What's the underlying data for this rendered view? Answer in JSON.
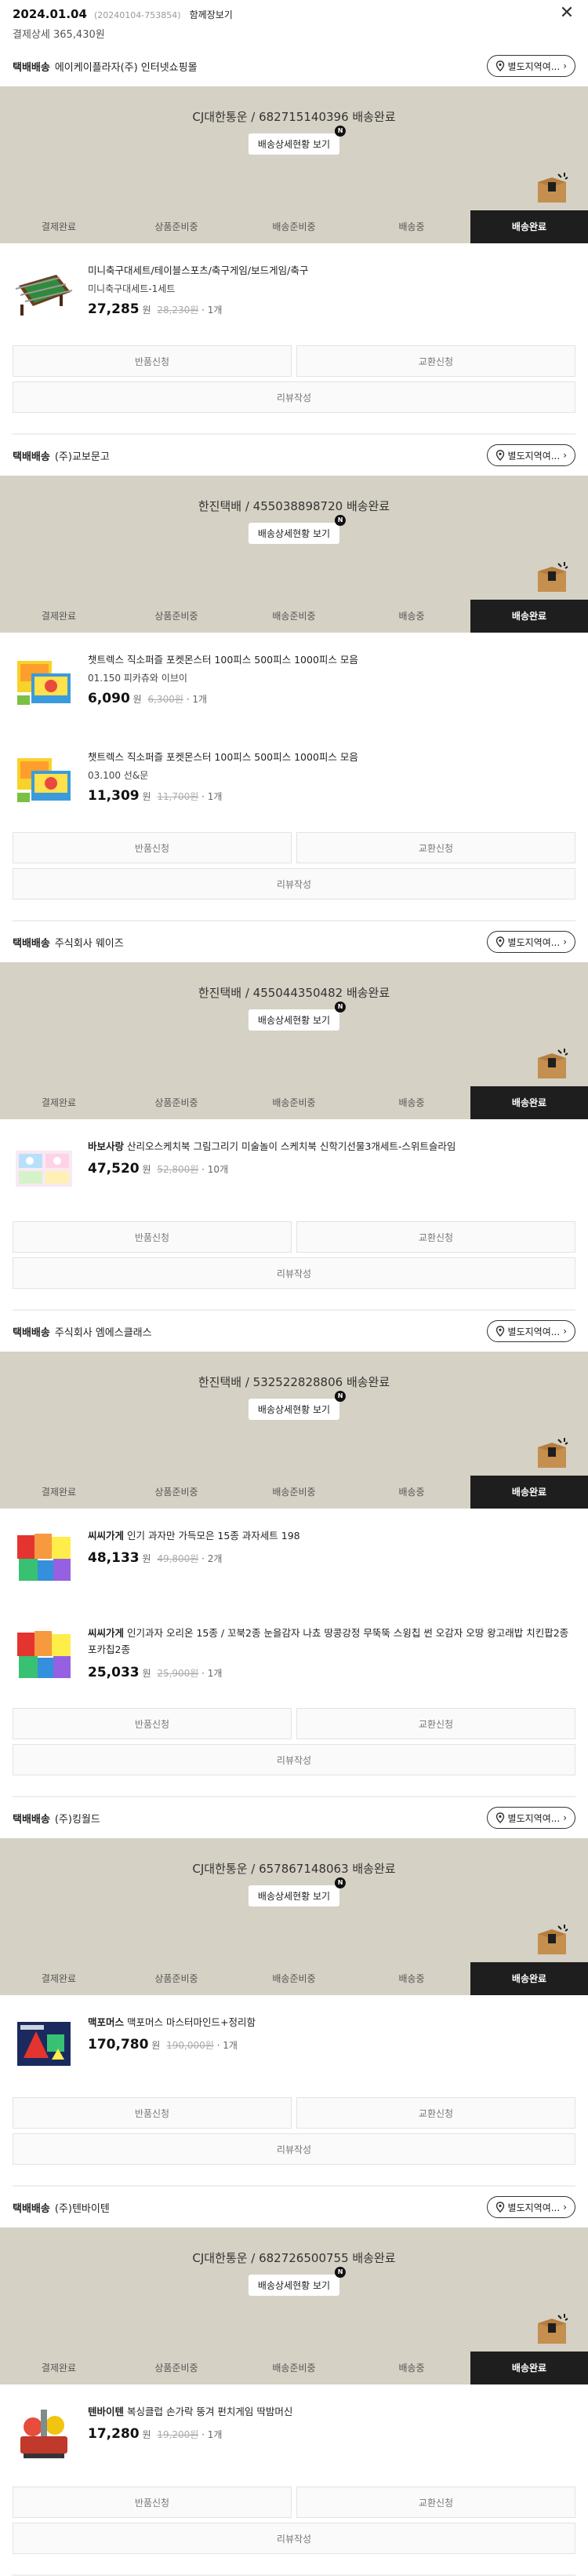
{
  "header": {
    "date": "2024.01.04",
    "order_no": "(20240104-753854)",
    "receipt_label": "함께장보기",
    "payment_detail": "결제상세 365,430원",
    "close_icon": "close-icon"
  },
  "steps": [
    "결제완료",
    "상품준비중",
    "배송준비중",
    "배송중",
    "배송완료"
  ],
  "shipments": [
    {
      "kind": "택배배송",
      "seller": "에이케이플라자(주) 인터넷쇼핑몰",
      "address_btn": "별도지역여...",
      "tracking": "CJ대한통운 / 682715140396 배송완료",
      "track_btn": "배송상세현황 보기",
      "badge": "N",
      "items": [
        {
          "brand": "",
          "name": "미니축구대세트/테이블스포츠/축구게임/보드게임/축구",
          "option": "미니축구대세트-1세트",
          "price": "27,285",
          "won": "원",
          "orig": "28,230원",
          "qty": "· 1개",
          "thumb": "foosball"
        }
      ],
      "btn_return": "반품신청",
      "btn_exchange": "교환신청",
      "btn_review": "리뷰작성"
    },
    {
      "kind": "택배배송",
      "seller": "(주)교보문고",
      "address_btn": "별도지역여...",
      "tracking": "한진택배 / 455038898720 배송완료",
      "track_btn": "배송상세현황 보기",
      "badge": "N",
      "items": [
        {
          "brand": "",
          "name": "챗트렉스 직소퍼즐 포켓몬스터 100피스 500피스 1000피스 모음",
          "option": "01.150 피카츄와 이브이",
          "price": "6,090",
          "won": "원",
          "orig": "6,300원",
          "qty": "· 1개",
          "thumb": "puzzle"
        },
        {
          "brand": "",
          "name": "챗트렉스 직소퍼즐 포켓몬스터 100피스 500피스 1000피스 모음",
          "option": "03.100 선&문",
          "price": "11,309",
          "won": "원",
          "orig": "11,700원",
          "qty": "· 1개",
          "thumb": "puzzle"
        }
      ],
      "btn_return": "반품신청",
      "btn_exchange": "교환신청",
      "btn_review": "리뷰작성"
    },
    {
      "kind": "택배배송",
      "seller": "주식회사 웨이즈",
      "address_btn": "별도지역여...",
      "tracking": "한진택배 / 455044350482 배송완료",
      "track_btn": "배송상세현황 보기",
      "badge": "N",
      "items": [
        {
          "brand": "바보사랑",
          "name": "산리오스케치북 그림그리기 미술놀이 스케치북 신학기선물3개세트-스위트슬라임",
          "option": "",
          "price": "47,520",
          "won": "원",
          "orig": "52,800원",
          "qty": "· 10개",
          "thumb": "sketch"
        }
      ],
      "btn_return": "반품신청",
      "btn_exchange": "교환신청",
      "btn_review": "리뷰작성"
    },
    {
      "kind": "택배배송",
      "seller": "주식회사 엠에스클래스",
      "address_btn": "별도지역여...",
      "tracking": "한진택배 / 532522828806 배송완료",
      "track_btn": "배송상세현황 보기",
      "badge": "N",
      "items": [
        {
          "brand": "씨씨가게",
          "name": "인기 과자만 가득모은 15종 과자세트 198",
          "option": "",
          "price": "48,133",
          "won": "원",
          "orig": "49,800원",
          "qty": "· 2개",
          "thumb": "snack"
        },
        {
          "brand": "씨씨가게",
          "name": "인기과자 오리온 15종 / 꼬북2종 눈을감자 나쵸 땅콩강정 무뚝뚝 스윙칩 썬 오감자 오땅 왕고래밥 치킨팝2종 포카칩2종",
          "option": "",
          "price": "25,033",
          "won": "원",
          "orig": "25,900원",
          "qty": "· 1개",
          "thumb": "snack"
        }
      ],
      "btn_return": "반품신청",
      "btn_exchange": "교환신청",
      "btn_review": "리뷰작성"
    },
    {
      "kind": "택배배송",
      "seller": "(주)킹월드",
      "address_btn": "별도지역여...",
      "tracking": "CJ대한통운 / 657867148063 배송완료",
      "track_btn": "배송상세현황 보기",
      "badge": "N",
      "items": [
        {
          "brand": "맥포머스",
          "name": "맥포머스 마스터마인드+정리함",
          "option": "",
          "price": "170,780",
          "won": "원",
          "orig": "190,000원",
          "qty": "· 1개",
          "thumb": "magformers"
        }
      ],
      "btn_return": "반품신청",
      "btn_exchange": "교환신청",
      "btn_review": "리뷰작성"
    },
    {
      "kind": "택배배송",
      "seller": "(주)텐바이텐",
      "address_btn": "별도지역여...",
      "tracking": "CJ대한통운 / 682726500755 배송완료",
      "track_btn": "배송상세현황 보기",
      "badge": "N",
      "items": [
        {
          "brand": "텐바이텐",
          "name": "복싱클럽 손가락 뚱겨 펀치게임 딱밤머신",
          "option": "",
          "price": "17,280",
          "won": "원",
          "orig": "19,200원",
          "qty": "· 1개",
          "thumb": "boxing"
        }
      ],
      "btn_return": "반품신청",
      "btn_exchange": "교환신청",
      "btn_review": "리뷰작성"
    }
  ]
}
